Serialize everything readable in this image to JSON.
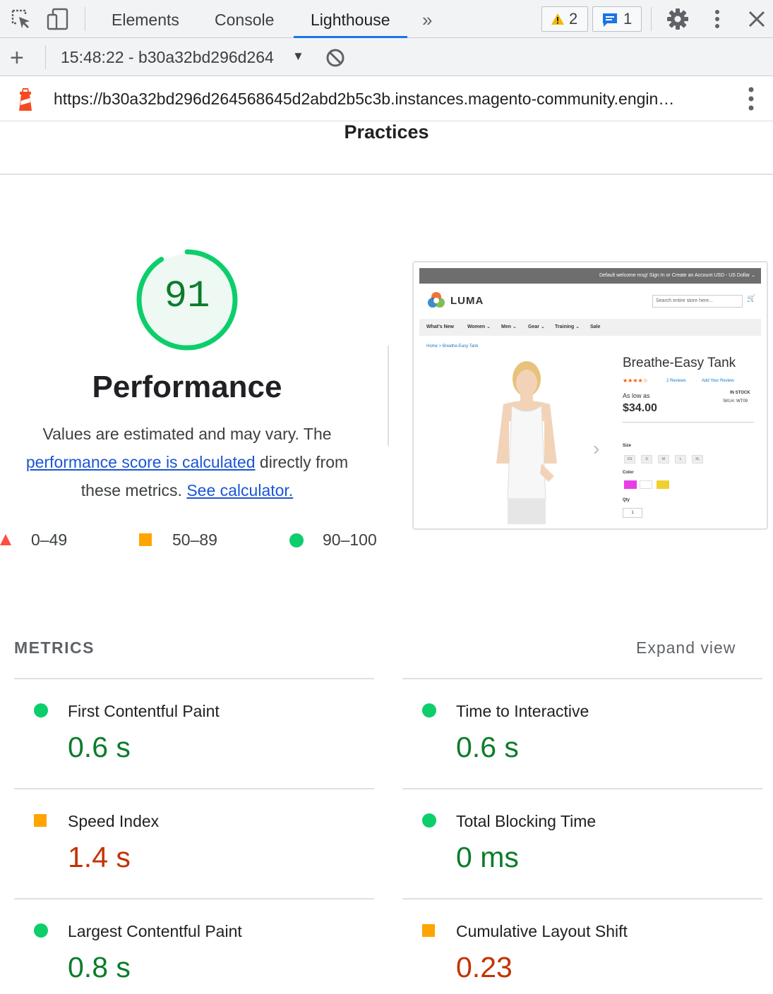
{
  "devtools": {
    "tabs": [
      {
        "label": "Elements",
        "active": false
      },
      {
        "label": "Console",
        "active": false
      },
      {
        "label": "Lighthouse",
        "active": true
      }
    ],
    "more_tabs_label": "»",
    "warnings_count": "2",
    "messages_count": "1",
    "icons": [
      "inspect-icon",
      "device-toggle-icon",
      "chevrons-icon",
      "warning-icon",
      "message-icon",
      "gear-icon",
      "kebab-icon",
      "close-icon"
    ]
  },
  "report_bar": {
    "add_label": "+",
    "selected_report": "15:48:22 - b30a32bd296d264",
    "caret": "▼"
  },
  "url_bar": {
    "url": "https://b30a32bd296d264568645d2abd2b5c3b.instances.magento-community.engin…"
  },
  "section_heading": "Practices",
  "performance": {
    "score": "91",
    "score_fraction": 0.91,
    "title": "Performance",
    "desc_prefix": "Values are estimated and may vary. The",
    "desc_link1": "performance score is calculated",
    "desc_mid": "directly from",
    "desc_suffix": "these metrics.",
    "desc_link2": "See calculator.",
    "legend": [
      {
        "range": "0–49",
        "color": "#ff4e42"
      },
      {
        "range": "50–89",
        "color": "#ffa400"
      },
      {
        "range": "90–100",
        "color": "#0cce6b"
      }
    ]
  },
  "thumbnail": {
    "top_strip": "Default welcome msg!   Sign In   or   Create an Account   USD - US Dollar ⌄",
    "brand": "LUMA",
    "search_placeholder": "Search entire store here...",
    "cart_icon": "🛒",
    "nav": [
      "What's New",
      "Women ⌄",
      "Men ⌄",
      "Gear ⌄",
      "Training ⌄",
      "Sale"
    ],
    "breadcrumbs": "Home   >   Breathe-Easy Tank",
    "product_name": "Breathe-Easy Tank",
    "stars": "★★★★☆",
    "reviews": "2 Reviews",
    "add_review": "Add Your Review",
    "as_low_as": "As low as",
    "price": "$34.00",
    "stock": "IN STOCK",
    "sku": "SKU#:   WT09",
    "size_label": "Size",
    "sizes": [
      "XS",
      "S",
      "M",
      "L",
      "XL"
    ],
    "color_label": "Color",
    "colors": [
      "#e83ee8",
      "#ffffff",
      "#f0d030"
    ],
    "qty_label": "Qty",
    "qty_value": "1",
    "next_arrow": "›"
  },
  "metrics": {
    "title": "METRICS",
    "expand_label": "Expand view",
    "items": [
      {
        "label": "First Contentful Paint",
        "value": "0.6 s",
        "rating": "good"
      },
      {
        "label": "Time to Interactive",
        "value": "0.6 s",
        "rating": "good"
      },
      {
        "label": "Speed Index",
        "value": "1.4 s",
        "rating": "average"
      },
      {
        "label": "Total Blocking Time",
        "value": "0 ms",
        "rating": "good"
      },
      {
        "label": "Largest Contentful Paint",
        "value": "0.8 s",
        "rating": "good"
      },
      {
        "label": "Cumulative Layout Shift",
        "value": "0.23",
        "rating": "average"
      }
    ]
  },
  "colors": {
    "pass": "#0cce6b",
    "average": "#ffa400",
    "fail": "#ff4e42",
    "good_text": "#0c7c2a",
    "average_text": "#c33300",
    "accent": "#1a73e8"
  }
}
